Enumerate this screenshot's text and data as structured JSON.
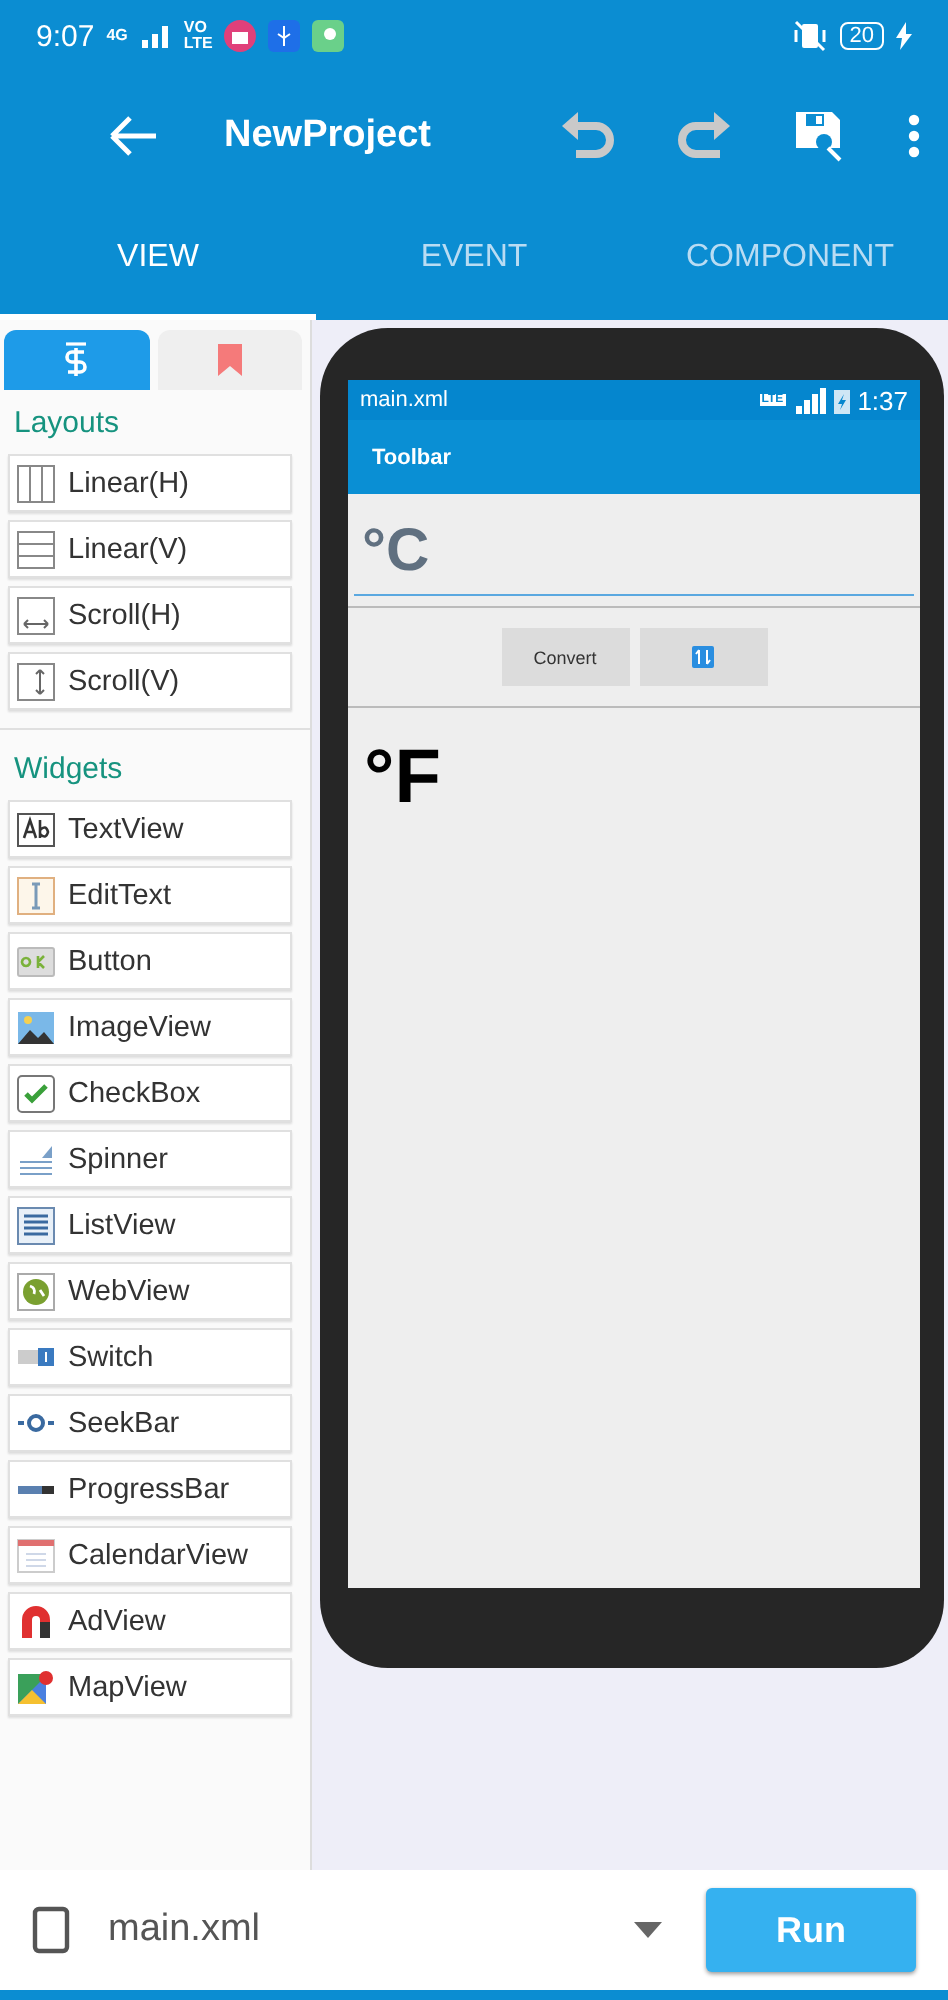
{
  "status_bar": {
    "time": "9:07",
    "network": "4G",
    "volte_top": "VO",
    "volte_bottom": "LTE",
    "battery": "20"
  },
  "app_bar": {
    "title": "NewProject"
  },
  "tabs": [
    {
      "label": "VIEW",
      "selected": true
    },
    {
      "label": "EVENT",
      "selected": false
    },
    {
      "label": "COMPONENT",
      "selected": false
    }
  ],
  "palette_tabs": [
    {
      "kind": "widgets",
      "selected": true
    },
    {
      "kind": "bookmark",
      "selected": false
    }
  ],
  "sections": [
    {
      "title": "Layouts",
      "items": [
        {
          "kind": "linearh",
          "label": "Linear(H)"
        },
        {
          "kind": "linearv",
          "label": "Linear(V)"
        },
        {
          "kind": "scrollh",
          "label": "Scroll(H)"
        },
        {
          "kind": "scrollv",
          "label": "Scroll(V)"
        }
      ]
    },
    {
      "title": "Widgets",
      "items": [
        {
          "kind": "textview",
          "label": "TextView"
        },
        {
          "kind": "edittext",
          "label": "EditText"
        },
        {
          "kind": "button",
          "label": "Button"
        },
        {
          "kind": "imageview",
          "label": "ImageView"
        },
        {
          "kind": "checkbox",
          "label": "CheckBox"
        },
        {
          "kind": "spinner",
          "label": "Spinner"
        },
        {
          "kind": "listview",
          "label": "ListView"
        },
        {
          "kind": "webview",
          "label": "WebView"
        },
        {
          "kind": "switch",
          "label": "Switch"
        },
        {
          "kind": "seekbar",
          "label": "SeekBar"
        },
        {
          "kind": "progressbar",
          "label": "ProgressBar"
        },
        {
          "kind": "calendarview",
          "label": "CalendarView"
        },
        {
          "kind": "adview",
          "label": "AdView"
        },
        {
          "kind": "mapview",
          "label": "MapView"
        }
      ]
    }
  ],
  "preview": {
    "status_title": "main.xml",
    "network": "LTE",
    "time": "1:37",
    "toolbar_title": "Toolbar",
    "input_value": "°C",
    "convert_button": "Convert",
    "output_text": "°F"
  },
  "bottom_bar": {
    "file": "main.xml",
    "run_button": "Run"
  }
}
